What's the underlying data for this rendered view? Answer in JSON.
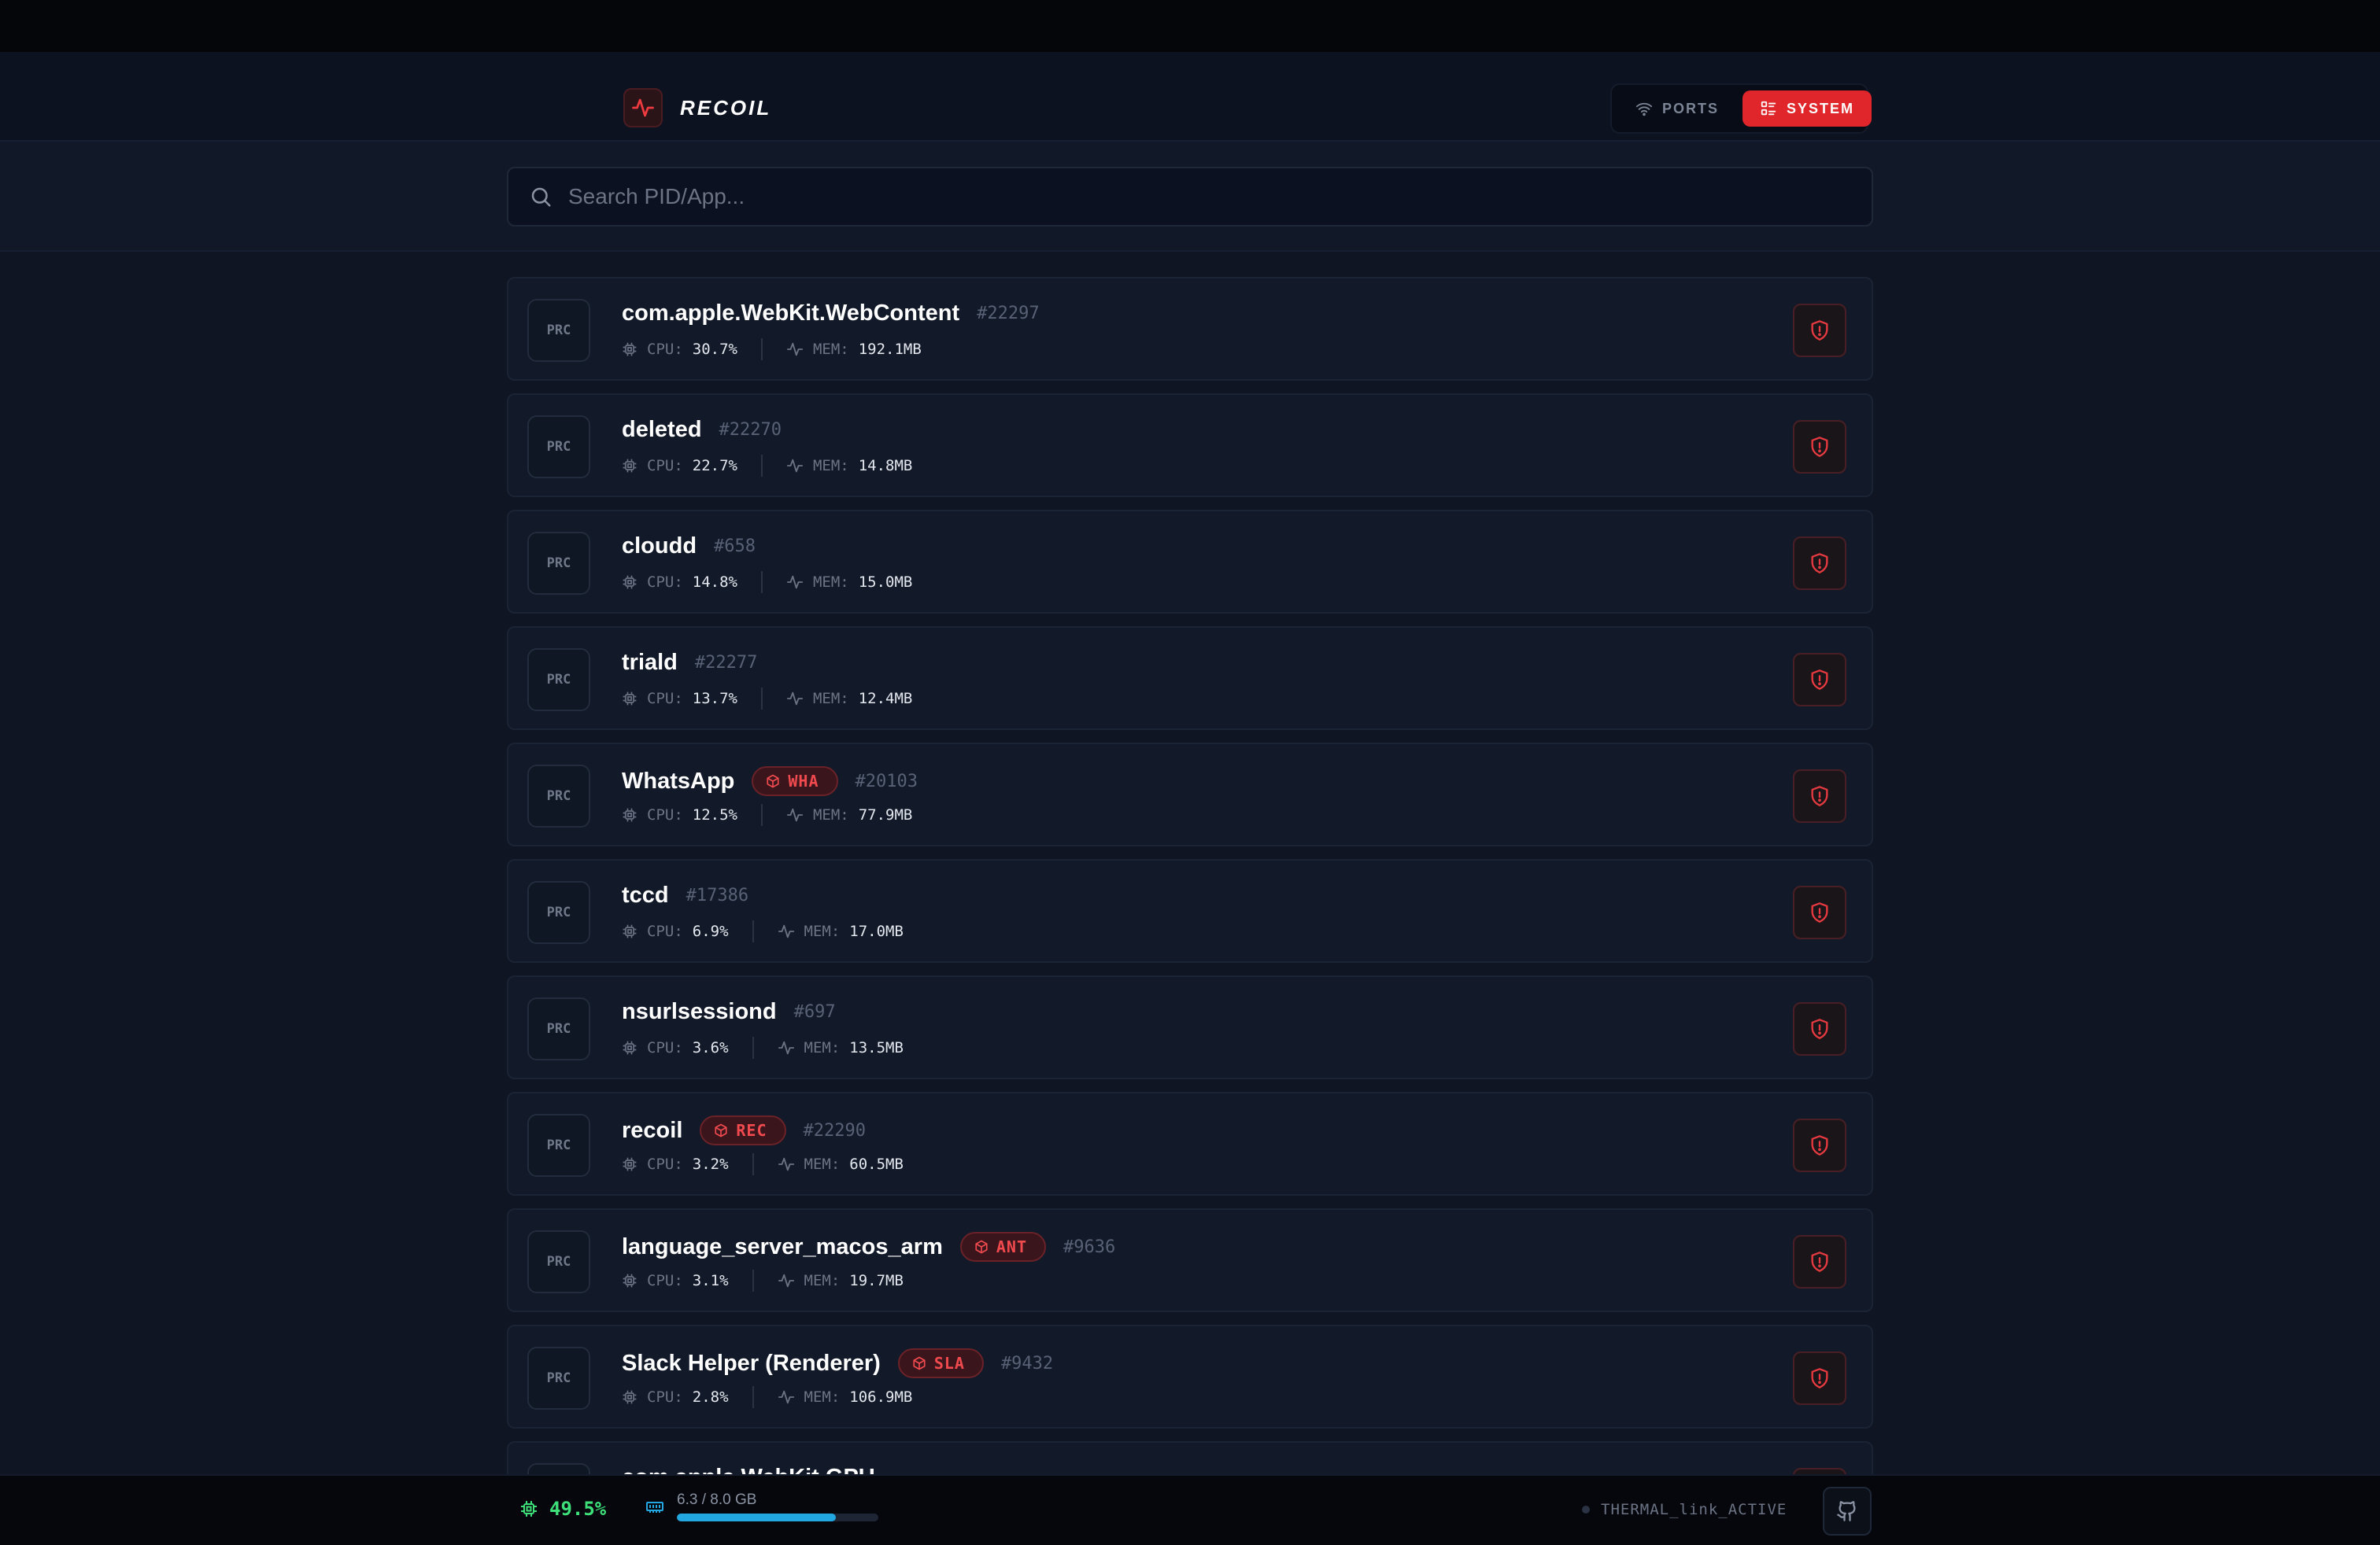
{
  "app": {
    "name": "RECOIL"
  },
  "nav": {
    "ports_label": "PORTS",
    "system_label": "SYSTEM",
    "active": "system"
  },
  "search": {
    "placeholder": "Search PID/App...",
    "value": ""
  },
  "labels": {
    "prc": "PRC",
    "cpu": "CPU:",
    "mem": "MEM:"
  },
  "processes": [
    {
      "name": "com.apple.WebKit.WebContent",
      "pid": "#22297",
      "tag": "",
      "cpu": "30.7%",
      "mem": "192.1MB"
    },
    {
      "name": "deleted",
      "pid": "#22270",
      "tag": "",
      "cpu": "22.7%",
      "mem": "14.8MB"
    },
    {
      "name": "cloudd",
      "pid": "#658",
      "tag": "",
      "cpu": "14.8%",
      "mem": "15.0MB"
    },
    {
      "name": "triald",
      "pid": "#22277",
      "tag": "",
      "cpu": "13.7%",
      "mem": "12.4MB"
    },
    {
      "name": "WhatsApp",
      "pid": "#20103",
      "tag": "WHA",
      "cpu": "12.5%",
      "mem": "77.9MB"
    },
    {
      "name": "tccd",
      "pid": "#17386",
      "tag": "",
      "cpu": "6.9%",
      "mem": "17.0MB"
    },
    {
      "name": "nsurlsessiond",
      "pid": "#697",
      "tag": "",
      "cpu": "3.6%",
      "mem": "13.5MB"
    },
    {
      "name": "recoil",
      "pid": "#22290",
      "tag": "REC",
      "cpu": "3.2%",
      "mem": "60.5MB"
    },
    {
      "name": "language_server_macos_arm",
      "pid": "#9636",
      "tag": "ANT",
      "cpu": "3.1%",
      "mem": "19.7MB"
    },
    {
      "name": "Slack Helper (Renderer)",
      "pid": "#9432",
      "tag": "SLA",
      "cpu": "2.8%",
      "mem": "106.9MB"
    },
    {
      "name": "com.apple.WebKit.GPU",
      "pid": "",
      "tag": "",
      "cpu": "",
      "mem": ""
    }
  ],
  "footer": {
    "cpu": "49.5%",
    "mem_text": "6.3 / 8.0 GB",
    "mem_fraction": 0.79,
    "status": "THERMAL_link_ACTIVE"
  },
  "colors": {
    "accent": "#e0262b",
    "cpu_green": "#3ee07a",
    "mem_blue": "#22a7e0"
  }
}
